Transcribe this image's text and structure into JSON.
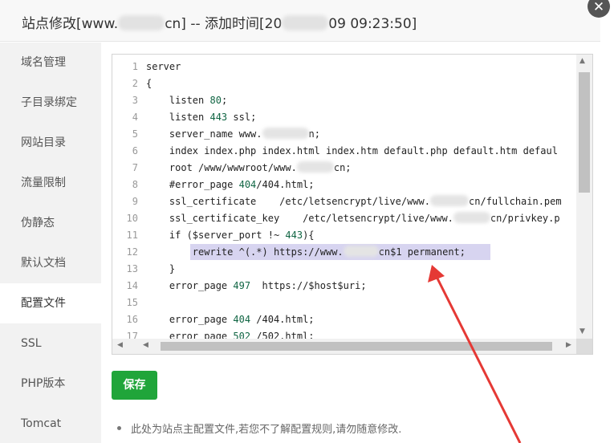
{
  "dialog": {
    "title_prefix": "站点修改[www.",
    "title_mid": "cn] -- 添加时间[20",
    "title_suffix": "09 09:23:50]",
    "close_glyph": "✕"
  },
  "sidebar": {
    "items": [
      {
        "label": "域名管理"
      },
      {
        "label": "子目录绑定"
      },
      {
        "label": "网站目录"
      },
      {
        "label": "流量限制"
      },
      {
        "label": "伪静态"
      },
      {
        "label": "默认文档"
      },
      {
        "label": "配置文件"
      },
      {
        "label": "SSL"
      },
      {
        "label": "PHP版本"
      },
      {
        "label": "Tomcat"
      }
    ],
    "active_index": 6
  },
  "editor": {
    "line_numbers": [
      "1",
      "2",
      "3",
      "4",
      "5",
      "6",
      "7",
      "8",
      "9",
      "10",
      "11",
      "12",
      "13",
      "14",
      "15",
      "16",
      "17"
    ],
    "lines": {
      "l1": "server",
      "l2": "{",
      "l3_a": "    listen ",
      "l3_num": "80",
      "l3_b": ";",
      "l4_a": "    listen ",
      "l4_num": "443",
      "l4_b": " ssl;",
      "l5_a": "    server_name www.",
      "l5_b": "n;",
      "l6": "    index index.php index.html index.htm default.php default.htm defaul",
      "l7_a": "    root /www/wwwroot/www.",
      "l7_b": "cn;",
      "l8_a": "    #error_page ",
      "l8_num": "404",
      "l8_b": "/404.html;",
      "l9_a": "    ssl_certificate    /etc/letsencrypt/live/www.",
      "l9_b": "cn/fullchain.pem",
      "l10_a": "    ssl_certificate_key    /etc/letsencrypt/live/www.",
      "l10_b": "cn/privkey.p",
      "l11_a": "    if ($server_port !~ ",
      "l11_num": "443",
      "l11_b": "){",
      "l12_a": "        rewrite ^(.*) https://www.",
      "l12_b": "cn$1 permanent;",
      "l13": "    }",
      "l14_a": "    error_page ",
      "l14_num": "497",
      "l14_b": "  https://$host$uri;",
      "l15": "",
      "l16_a": "    error_page ",
      "l16_num": "404",
      "l16_b": " /404.html;",
      "l17_a": "    error_page ",
      "l17_num": "502",
      "l17_b": " /502.html;"
    }
  },
  "actions": {
    "save_label": "保存"
  },
  "note": {
    "text": "此处为站点主配置文件,若您不了解配置规则,请勿随意修改."
  },
  "colors": {
    "save_green": "#20a53a",
    "highlight": "#d7d4f0",
    "annotation_arrow": "#e53935"
  }
}
